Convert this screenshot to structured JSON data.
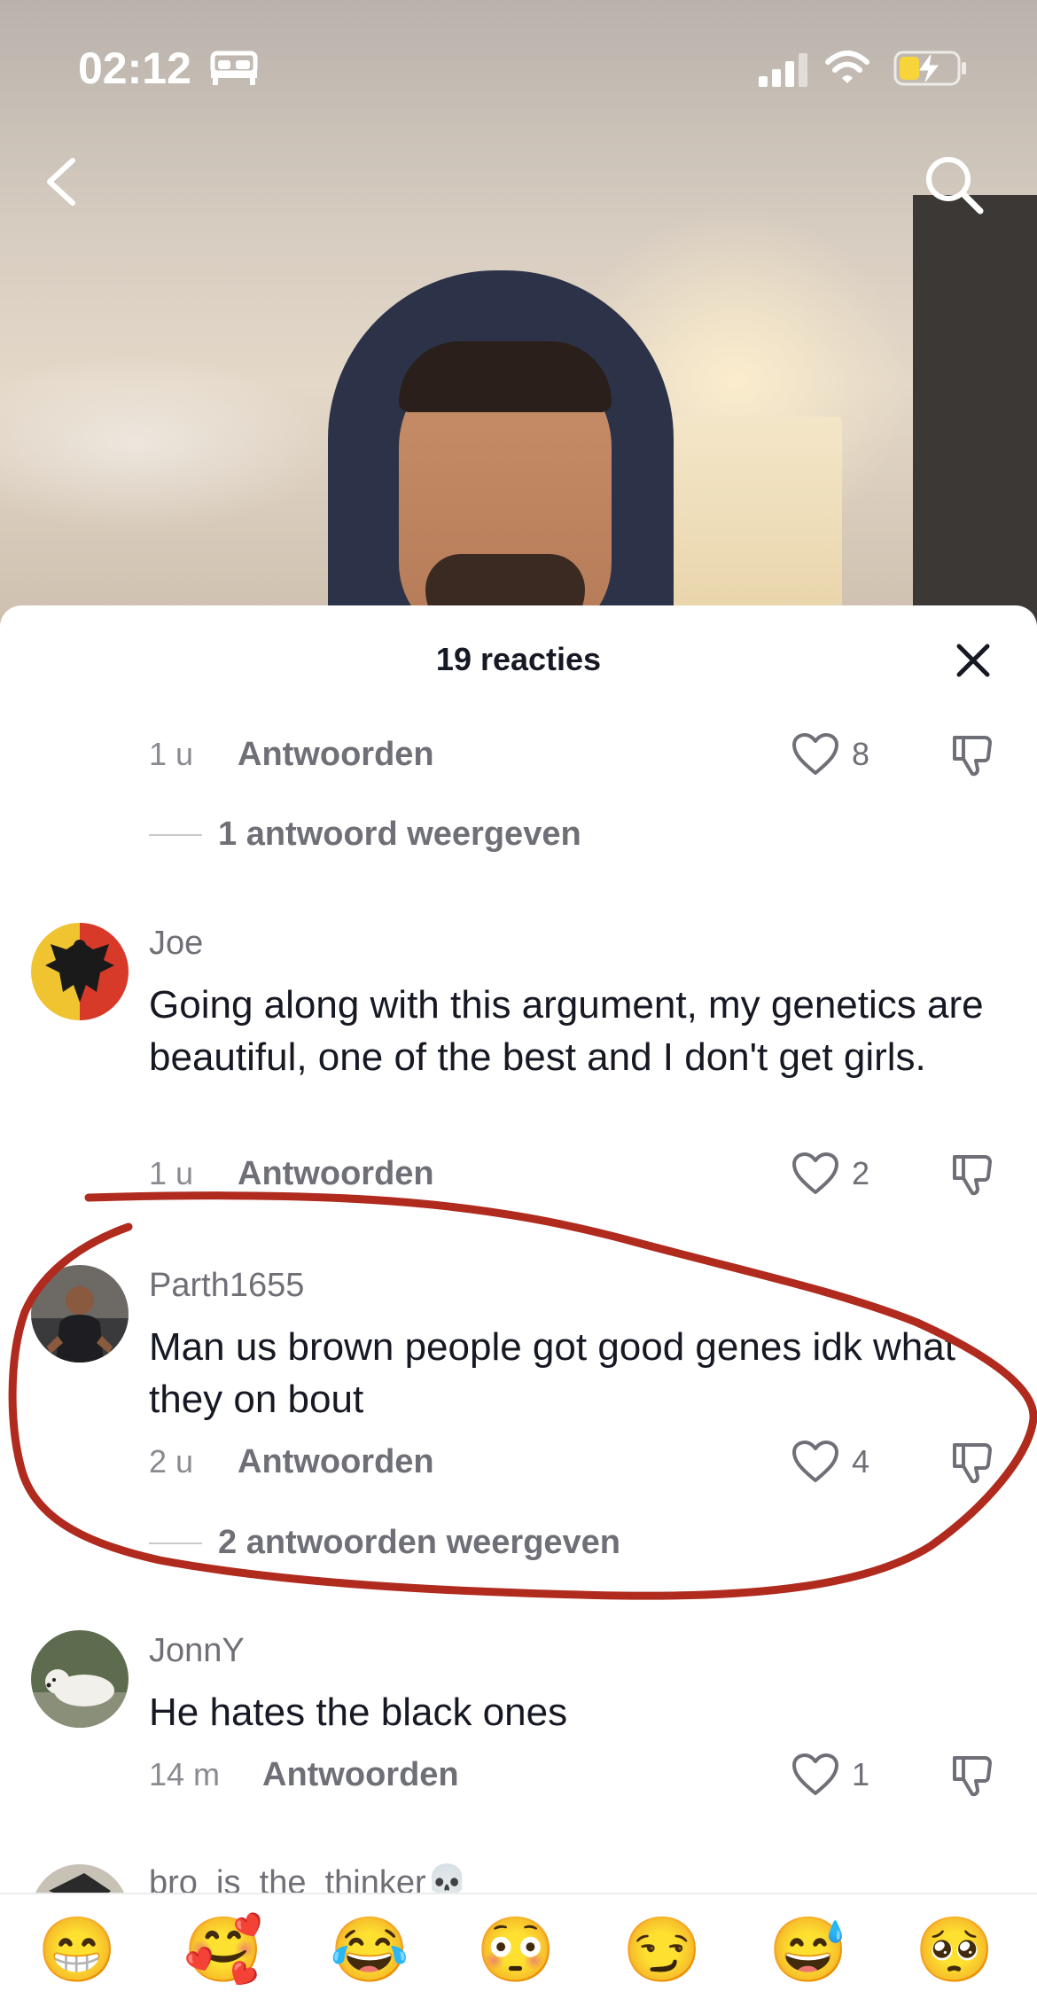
{
  "status_bar": {
    "time": "02:12",
    "icons": [
      "bed-icon",
      "signal-icon",
      "wifi-icon",
      "battery-charging-icon"
    ]
  },
  "nav": {
    "back_icon": "chevron-left-icon",
    "search_icon": "search-icon"
  },
  "sheet": {
    "title": "19 reacties",
    "close_icon": "close-icon"
  },
  "comments": [
    {
      "time": "1 u",
      "reply_label": "Antwoorden",
      "likes": "8",
      "view_replies": "1 antwoord weergeven"
    },
    {
      "username": "Joe",
      "text": "Going along with this argument, my genetics are beautiful, one of the best and I don't get girls.",
      "time": "1 u",
      "reply_label": "Antwoorden",
      "likes": "2"
    },
    {
      "username": "Parth1655",
      "text": "Man us brown people got good genes idk what they on bout",
      "time": "2 u",
      "reply_label": "Antwoorden",
      "likes": "4",
      "view_replies": "2 antwoorden weergeven"
    },
    {
      "username": "JonnY",
      "text": "He hates the black ones",
      "time": "14 m",
      "reply_label": "Antwoorden",
      "likes": "1"
    },
    {
      "username": "bro_is_the_thinker💀"
    }
  ],
  "annotation_color": "#b02a1e",
  "emoji_bar": [
    "😁",
    "🥰",
    "😂",
    "😳",
    "😏",
    "😅",
    "🥺"
  ]
}
